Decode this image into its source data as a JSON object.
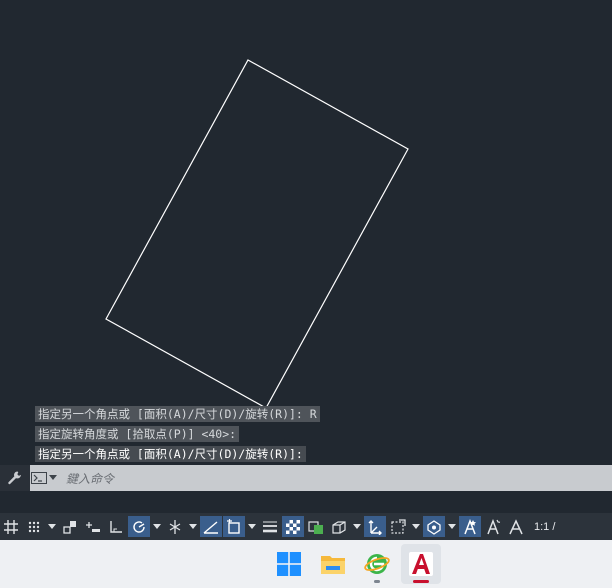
{
  "command_history": [
    "指定另一个角点或 [面积(A)/尺寸(D)/旋转(R)]: R",
    "指定旋转角度或 [拾取点(P)] <40>:",
    "指定另一个角点或 [面积(A)/尺寸(D)/旋转(R)]:"
  ],
  "command_line": {
    "placeholder": "鍵入命令"
  },
  "status_bar": {
    "annotation_scale": "1:1 /"
  },
  "drawing": {
    "entity": "rectangle",
    "rotation_degrees": 40,
    "stroke_color": "#ffffff"
  },
  "taskbar": {
    "apps": [
      {
        "icon": "windows-start-icon"
      },
      {
        "icon": "file-explorer-icon"
      },
      {
        "icon": "browser-icon"
      },
      {
        "icon": "autocad-icon",
        "active": true
      }
    ]
  },
  "colors": {
    "canvas": "#212830",
    "statusbar": "#2c333b",
    "toggle_on": "#3a5e8c",
    "taskbar": "#eef0f3",
    "autocad_red": "#c8102e"
  }
}
